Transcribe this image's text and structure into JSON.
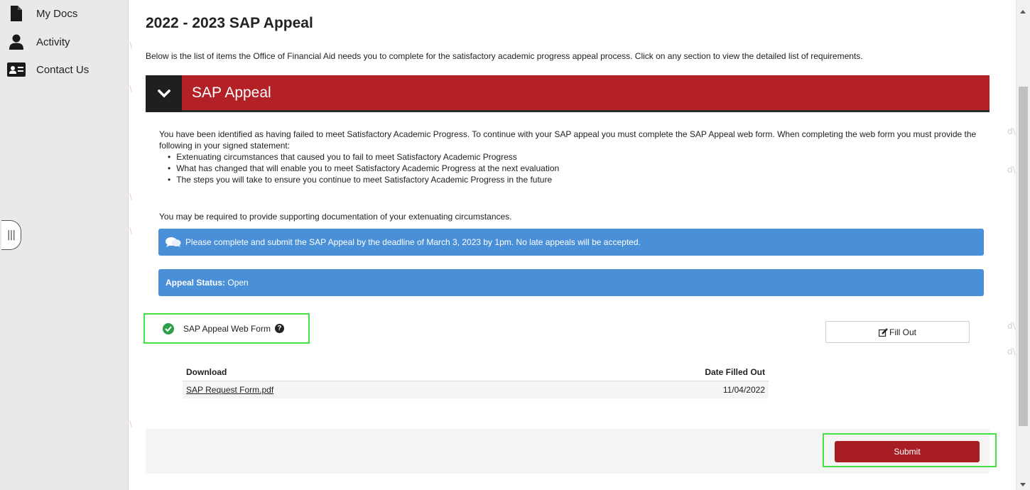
{
  "sidebar": {
    "items": [
      {
        "label": "My Docs",
        "icon": "document-icon"
      },
      {
        "label": "Activity",
        "icon": "person-icon"
      },
      {
        "label": "Contact Us",
        "icon": "contact-card-icon"
      }
    ],
    "collapse_glyph": "|||"
  },
  "main": {
    "title": "2022 - 2023 SAP Appeal",
    "intro": "Below is the list of items the Office of Financial Aid needs you to complete for the satisfactory academic progress appeal process. Click on any section to view the detailed list of requirements.",
    "section": {
      "title": "SAP Appeal",
      "body": "You have been identified as having failed to meet Satisfactory Academic Progress. To continue with your SAP appeal you must complete the SAP Appeal web form. When completing the web form you must provide the following in your signed statement:",
      "bullets": [
        "Extenuating circumstances that caused you to fail to meet Satisfactory Academic Progress",
        "What has changed that will enable you to meet Satisfactory Academic Progress at the next evaluation",
        "The steps you will take to ensure you continue to meet Satisfactory Academic Progress in the future"
      ],
      "support_note": "You may be required to provide supporting documentation of your extenuating circumstances.",
      "deadline_alert": "Please complete and submit the SAP Appeal by the deadline of March 3, 2023 by 1pm. No late appeals will be accepted.",
      "status_label": "Appeal Status:",
      "status_value": "Open",
      "form_item": {
        "label": "SAP Appeal Web Form",
        "help_glyph": "?",
        "fill_out_label": "Fill Out"
      },
      "downloads": {
        "columns": [
          "Download",
          "Date Filled Out"
        ],
        "rows": [
          {
            "file": "SAP Request Form.pdf",
            "date": "11/04/2022"
          }
        ]
      }
    },
    "submit_label": "Submit"
  },
  "colors": {
    "header_red": "#b32126",
    "alert_blue": "#4a90d9",
    "submit_red": "#a81d22",
    "highlight_green": "#44e044",
    "check_green": "#2e9e48"
  }
}
